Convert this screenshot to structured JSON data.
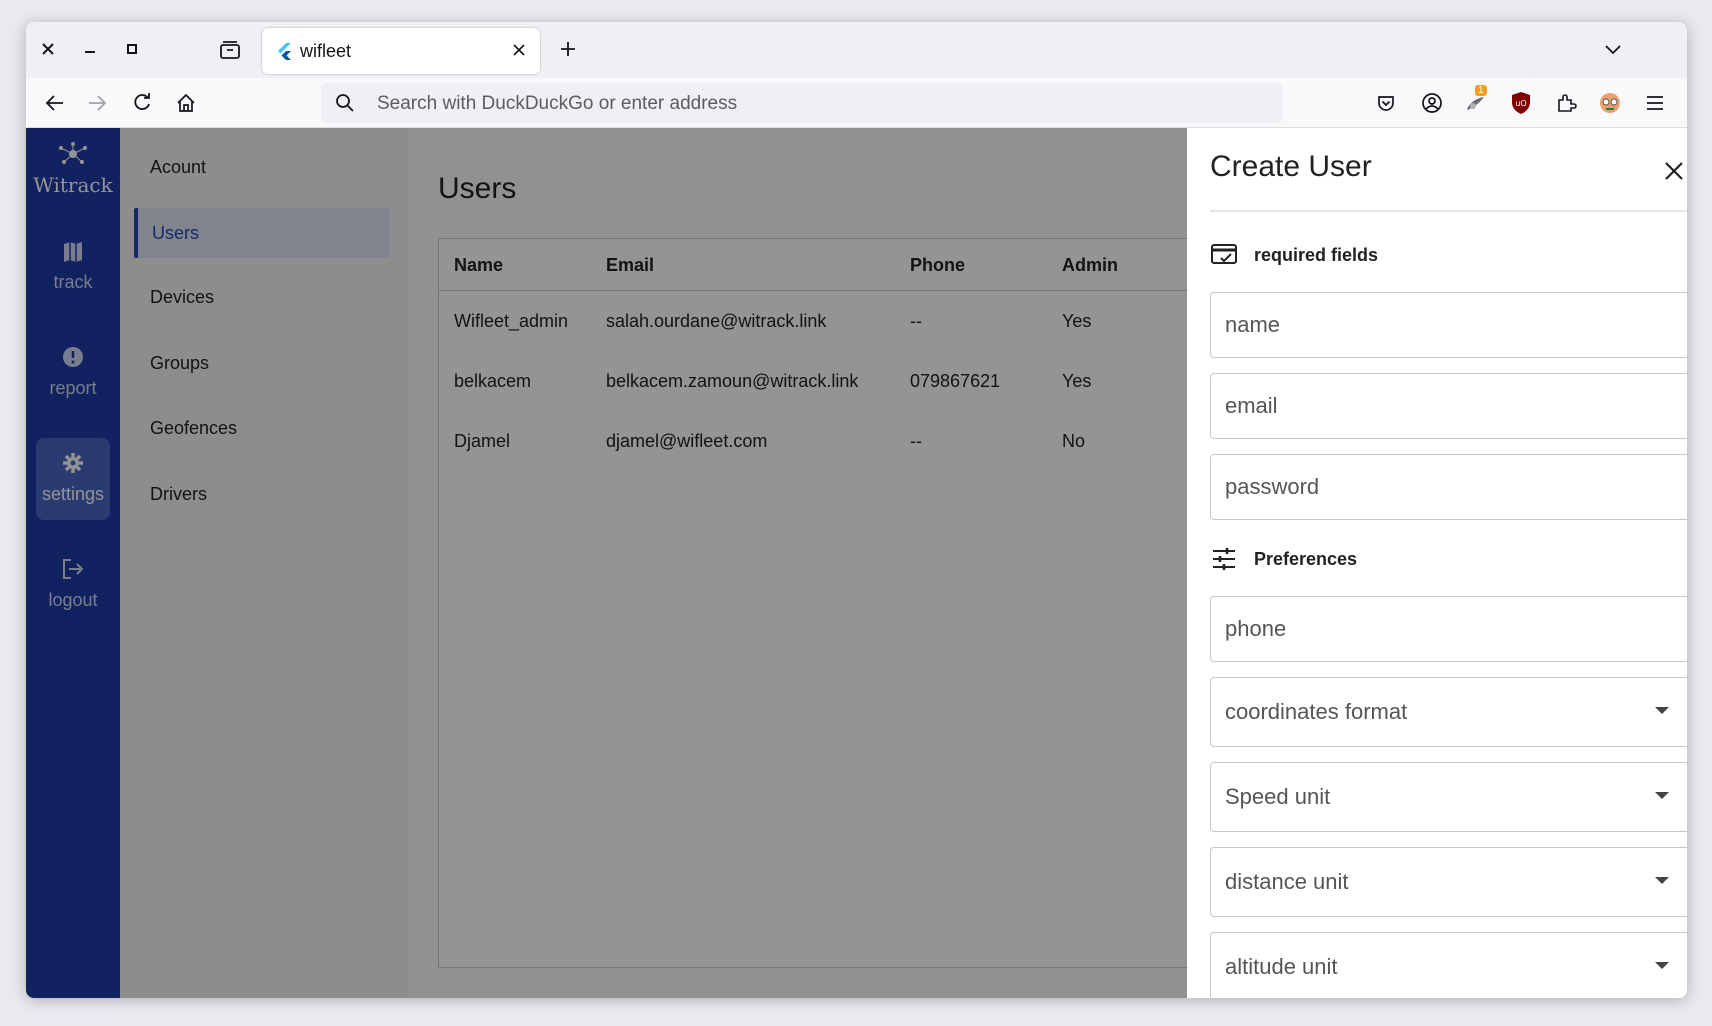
{
  "browser": {
    "tab_title": "wifleet",
    "url_placeholder": "Search with DuckDuckGo or enter address",
    "extension_badge": "1"
  },
  "app": {
    "logo_text": "Witrack",
    "rail": [
      {
        "label": "track",
        "icon": "map-icon"
      },
      {
        "label": "report",
        "icon": "alert-circle-icon"
      },
      {
        "label": "settings",
        "icon": "gear-icon"
      },
      {
        "label": "logout",
        "icon": "logout-icon"
      }
    ],
    "settings_menu": [
      "Acount",
      "Users",
      "Devices",
      "Groups",
      "Geofences",
      "Drivers"
    ],
    "active_menu": "Users",
    "accent_color": "#1f3ca6"
  },
  "users_page": {
    "title": "Users",
    "columns": [
      "Name",
      "Email",
      "Phone",
      "Admin"
    ],
    "rows": [
      [
        "Wifleet_admin",
        "salah.ourdane@witrack.link",
        "--",
        "Yes"
      ],
      [
        "belkacem",
        "belkacem.zamoun@witrack.link",
        "079867621",
        "Yes"
      ],
      [
        "Djamel",
        "djamel@wifleet.com",
        "--",
        "No"
      ]
    ]
  },
  "create_user": {
    "title": "Create User",
    "required_section": "required fields",
    "name_placeholder": "name",
    "email_placeholder": "email",
    "password_placeholder": "password",
    "preferences_section": "Preferences",
    "phone_placeholder": "phone",
    "coordinates_format": "coordinates format",
    "speed_unit": "Speed unit",
    "distance_unit": "distance unit",
    "altitude_unit": "altitude unit"
  }
}
